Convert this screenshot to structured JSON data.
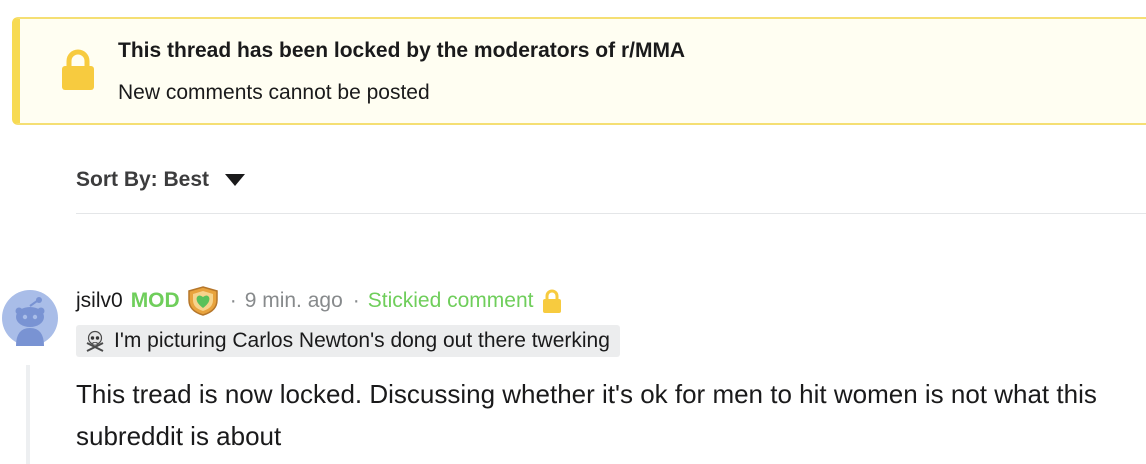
{
  "lock_notice": {
    "title": "This thread has been locked by the moderators of r/MMA",
    "subtitle": "New comments cannot be posted",
    "icon": "lock-icon",
    "accent": "#f7da52"
  },
  "sort": {
    "label": "Sort By: Best",
    "icon": "caret-down-icon"
  },
  "comment": {
    "author": "jsilv0",
    "mod_label": "MOD",
    "separator": "·",
    "time": "9 min. ago",
    "stickied_label": "Stickied comment",
    "flair": "I'm picturing Carlos Newton's dong out there twerking",
    "flair_icon": "skull-crossbones-icon",
    "body": "This tread is now locked. Discussing whether it's ok for men to hit women is not what this subreddit is about",
    "mod_color": "#6fce5b"
  }
}
